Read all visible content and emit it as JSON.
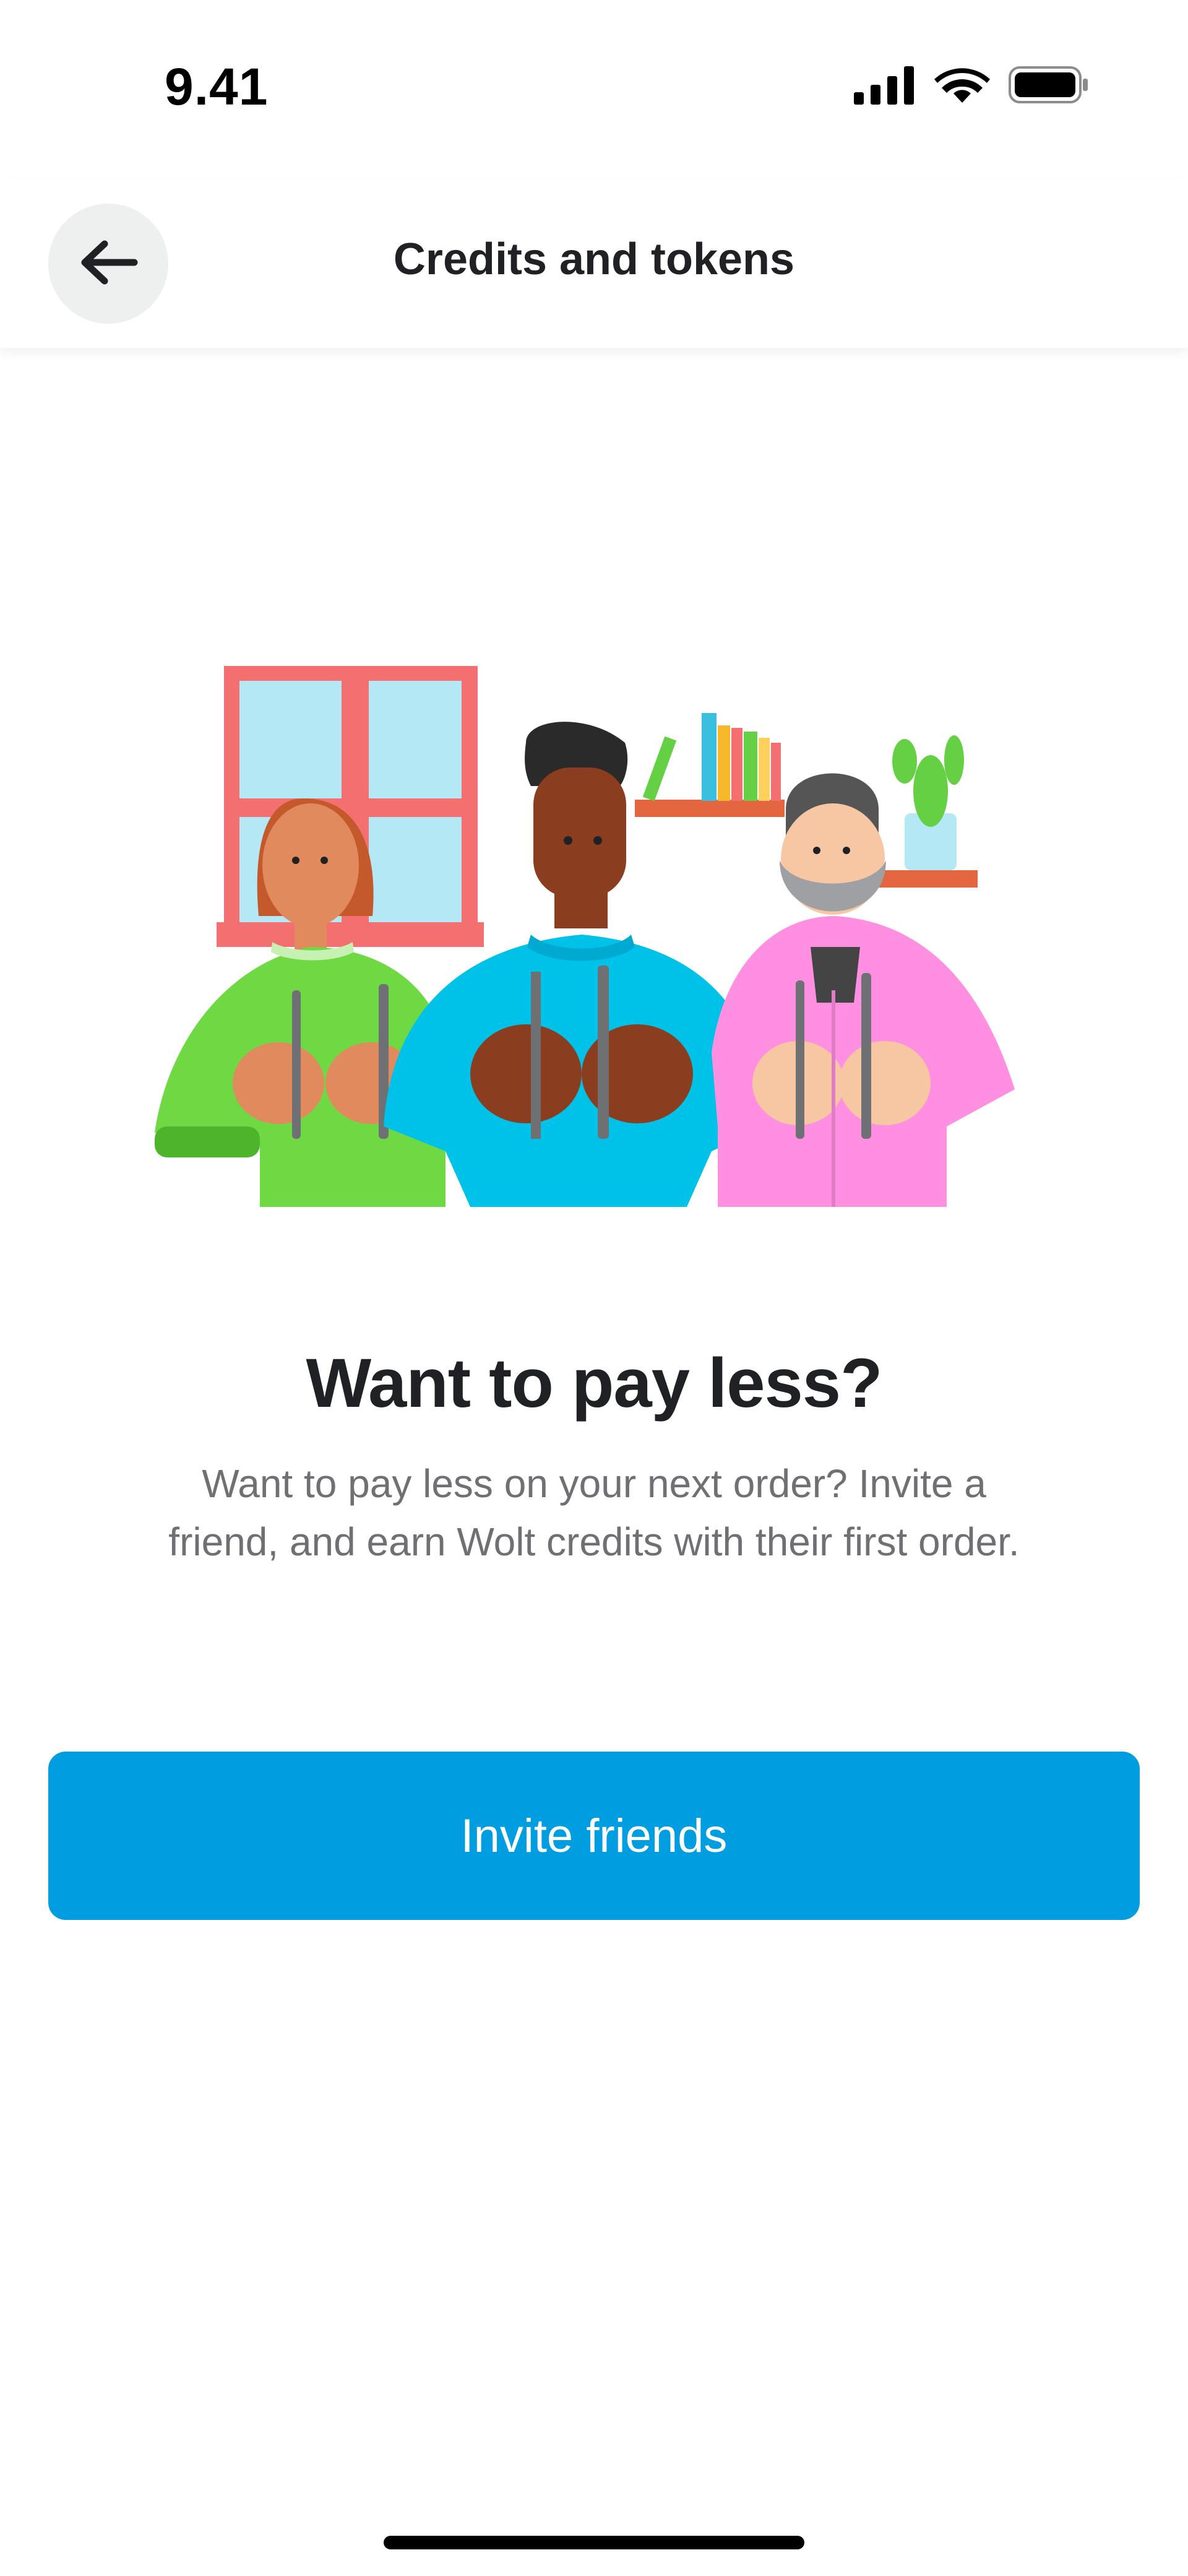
{
  "status_bar": {
    "time": "9.41",
    "icons": [
      "signal-icon",
      "wifi-icon",
      "battery-icon"
    ]
  },
  "header": {
    "title": "Credits and tokens",
    "back_icon": "arrow-left-icon"
  },
  "main": {
    "illustration": "three-people-with-cutlery-illustration",
    "headline": "Want to pay less?",
    "description": "Want to pay less on your next order? Invite a friend, and earn Wolt credits with their first order.",
    "invite_button_label": "Invite friends"
  },
  "colors": {
    "accent": "#009de0",
    "title_text": "#202125",
    "secondary_text": "#6f7073",
    "back_button_bg": "#eeefef"
  }
}
